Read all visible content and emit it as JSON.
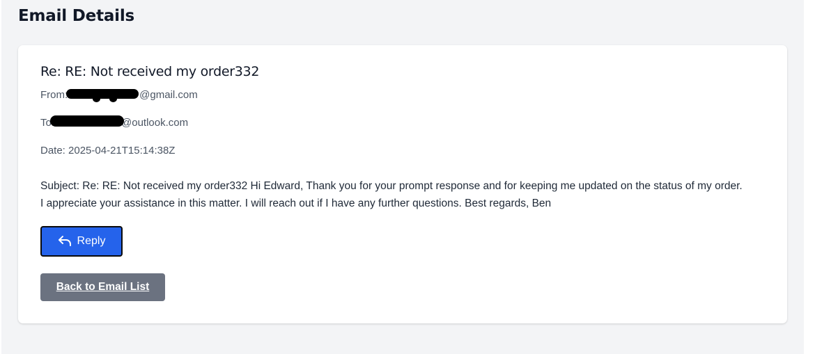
{
  "page": {
    "title": "Email Details"
  },
  "email": {
    "subject_heading": "Re: RE: Not received my order332",
    "from_label": "From:",
    "from_domain": "@gmail.com",
    "to_label": "To:",
    "to_domain": "@outlook.com",
    "date_label": "Date:",
    "date_value": "2025-04-21T15:14:38Z",
    "body_line_1": "Subject: Re: RE: Not received my order332 Hi Edward, Thank you for your prompt response and for keeping me updated on the status of my order.",
    "body_line_2": "I appreciate your assistance in this matter. I will reach out if I have any further questions. Best regards, Ben"
  },
  "actions": {
    "reply_label": "Reply",
    "back_label": "Back to Email List"
  },
  "colors": {
    "page_background": "#f3f4f6",
    "card_background": "#ffffff",
    "reply_button": "#2563eb",
    "back_button": "#6b7280"
  },
  "icons": {
    "reply": "reply-arrow-icon"
  }
}
